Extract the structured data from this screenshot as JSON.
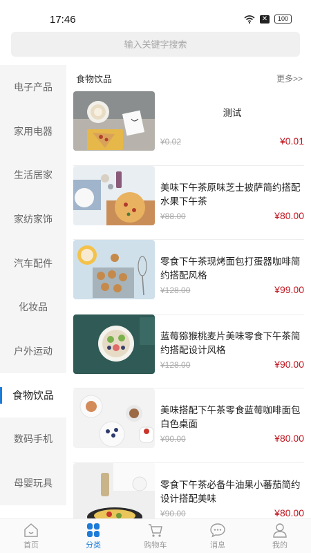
{
  "status": {
    "time": "17:46",
    "battery": "100"
  },
  "search": {
    "placeholder": "输入关键字搜索"
  },
  "sidebar": {
    "items": [
      {
        "label": "电子产品",
        "active": false
      },
      {
        "label": "家用电器",
        "active": false
      },
      {
        "label": "生活居家",
        "active": false
      },
      {
        "label": "家纺家饰",
        "active": false
      },
      {
        "label": "汽车配件",
        "active": false
      },
      {
        "label": "化妆品",
        "active": false
      },
      {
        "label": "户外运动",
        "active": false
      },
      {
        "label": "食物饮品",
        "active": true
      },
      {
        "label": "数码手机",
        "active": false
      },
      {
        "label": "母婴玩具",
        "active": false
      }
    ]
  },
  "content": {
    "title": "食物饮品",
    "more": "更多>>",
    "products": [
      {
        "name": "测试",
        "old_price": "¥0.02",
        "price": "¥0.01"
      },
      {
        "name": "美味下午茶原味芝士披萨简约搭配水果下午茶",
        "old_price": "¥88.00",
        "price": "¥80.00"
      },
      {
        "name": "零食下午茶现烤面包打蛋器咖啡简约搭配风格",
        "old_price": "¥128.00",
        "price": "¥99.00"
      },
      {
        "name": "蓝莓猕猴桃麦片美味零食下午茶简约搭配设计风格",
        "old_price": "¥128.00",
        "price": "¥90.00"
      },
      {
        "name": "美味搭配下午茶零食蓝莓咖啡面包白色桌面",
        "old_price": "¥90.00",
        "price": "¥80.00"
      },
      {
        "name": "零食下午茶必备牛油果小蕃茄简约设计搭配美味",
        "old_price": "¥90.00",
        "price": "¥80.00"
      }
    ]
  },
  "tabbar": {
    "items": [
      {
        "label": "首页",
        "icon": "home-icon"
      },
      {
        "label": "分类",
        "icon": "category-icon"
      },
      {
        "label": "购物车",
        "icon": "cart-icon"
      },
      {
        "label": "消息",
        "icon": "message-icon"
      },
      {
        "label": "我的",
        "icon": "profile-icon"
      }
    ],
    "active_color": "#1e7bd8",
    "inactive_color": "#999999"
  },
  "colors": {
    "price": "#c0121d",
    "accent": "#1e7bd8",
    "sidebar_bg": "#f5f5f5"
  }
}
